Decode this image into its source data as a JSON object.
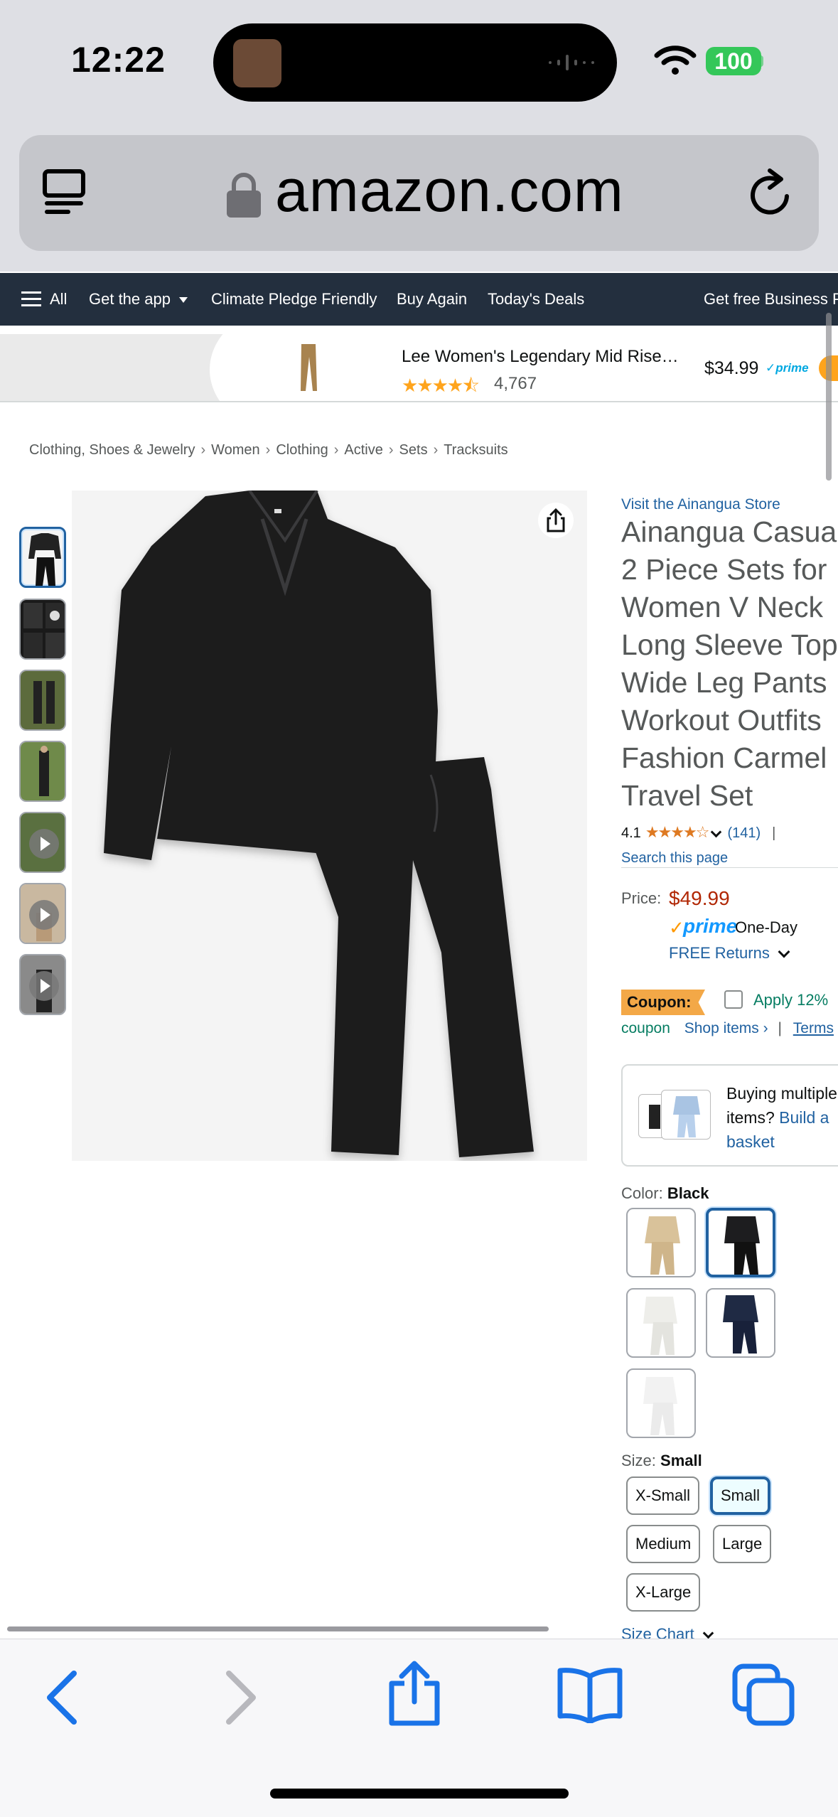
{
  "status_bar": {
    "time": "12:22",
    "battery": "100"
  },
  "browser": {
    "url": "amazon.com"
  },
  "nav": {
    "all": "All",
    "get_app": "Get the app",
    "climate": "Climate Pledge Friendly",
    "buy_again": "Buy Again",
    "deals": "Today's Deals",
    "business": "Get free Business Pr"
  },
  "sticky": {
    "title": "Lee Women's Legendary Mid Rise…",
    "stars": "★★★★⯪",
    "count": "4,767",
    "price": "$34.99",
    "prime": "✓prime"
  },
  "breadcrumb": [
    "Clothing, Shoes & Jewelry",
    "Women",
    "Clothing",
    "Active",
    "Sets",
    "Tracksuits"
  ],
  "product": {
    "store": "Visit the Ainangua Store",
    "title_lines": [
      "Ainangua Casual",
      "2 Piece Sets for",
      "Women V Neck",
      "Long Sleeve Tops",
      "Wide Leg Pants",
      "Workout Outfits",
      "Fashion Carmel",
      "Travel Set"
    ],
    "rating": "4.1",
    "rating_stars": "★★★★☆",
    "rating_count": "(141)",
    "rating_sep": "|",
    "search_page": "Search this page",
    "price_label": "Price:",
    "price": "$49.99",
    "prime_check": "✓",
    "prime": "prime",
    "one_day": "One-Day",
    "free_returns": "FREE Returns",
    "coupon_badge": "Coupon:",
    "coupon_apply": "Apply 12%",
    "coupon_word": "coupon",
    "shop_items": "Shop items ›",
    "pipe": "|",
    "terms": "Terms",
    "basket_text": "Buying multiple items?",
    "basket_link": "Build a basket",
    "color_label": "Color:",
    "color_value": "Black",
    "size_label": "Size:",
    "size_value": "Small",
    "sizes": [
      "X-Small",
      "Small",
      "Medium",
      "Large",
      "X-Large"
    ],
    "size_chart": "Size Chart"
  },
  "colors": {
    "accent": "#2162a1",
    "price": "#b12704",
    "nav_bg": "#232f3e",
    "coupon": "#f3a847"
  }
}
